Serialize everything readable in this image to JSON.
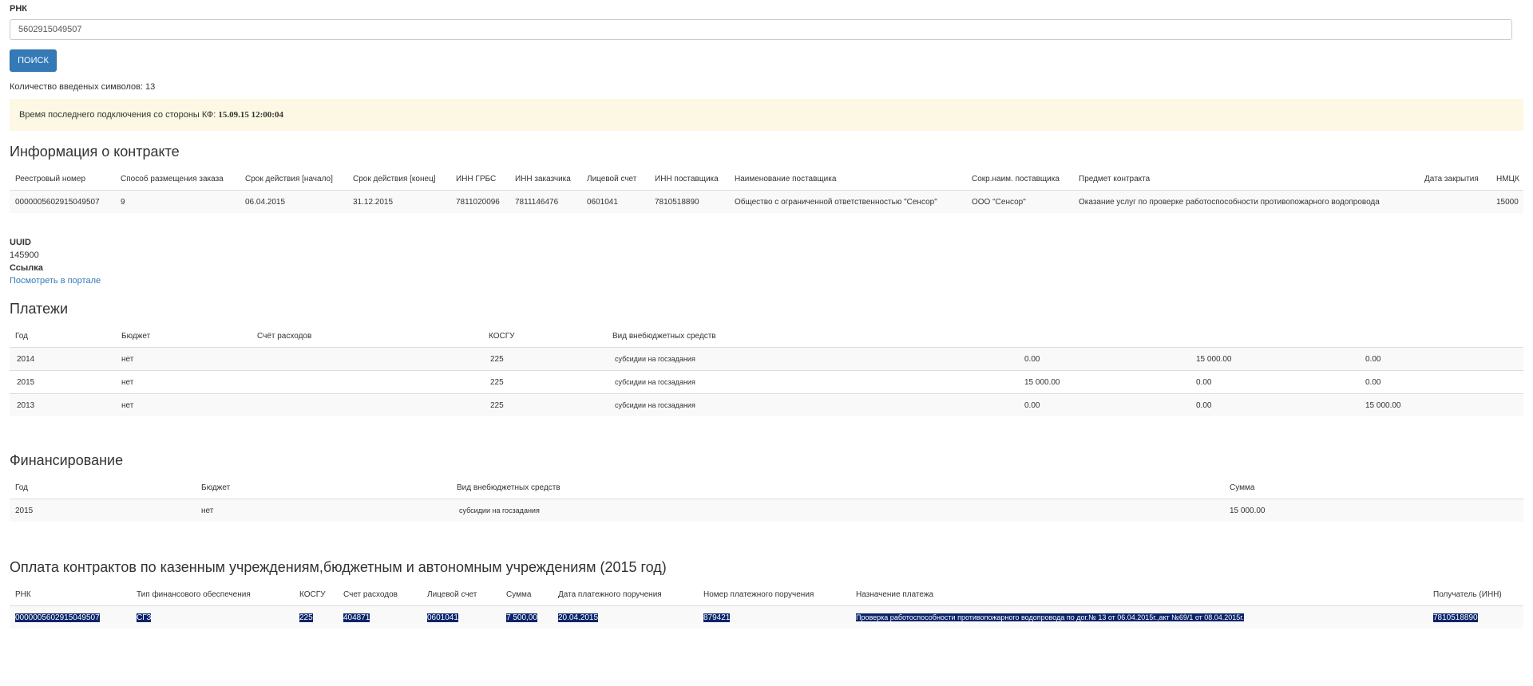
{
  "search": {
    "label": "РНК",
    "value": "5602915049507",
    "button": "ПОИСК",
    "char_count": "Количество введеных символов: 13"
  },
  "alert": {
    "text": "Время последнего подключения со стороны КФ:",
    "datetime": "15.09.15 12:00:04"
  },
  "contract": {
    "title": "Информация о контракте",
    "headers": [
      "Реестровый номер",
      "Способ размещения заказа",
      "Срок действия [начало]",
      "Срок действия [конец]",
      "ИНН ГРБС",
      "ИНН заказчика",
      "Лицевой счет",
      "ИНН поставщика",
      "Наименование поставщика",
      "Сокр.наим. поставщика",
      "Предмет контракта",
      "Дата закрытия",
      "НМЦК"
    ],
    "row": [
      "0000005602915049507",
      "9",
      "06.04.2015",
      "31.12.2015",
      "7811020096",
      "7811146476",
      "0601041",
      "7810518890",
      "Общество с ограниченной ответственностью \"Сенсор\"",
      "ООО \"Сенсор\"",
      "Оказание услуг по проверке работоспособности противопожарного водопровода",
      "",
      "15000"
    ]
  },
  "meta": {
    "uuid_label": "UUID",
    "uuid_value": "145900",
    "link_label": "Ссылка",
    "link_text": "Посмотреть в портале"
  },
  "payments": {
    "title": "Платежи",
    "headers": [
      "Год",
      "Бюджет",
      "Счёт расходов",
      "КОСГУ",
      "Вид внебюджетных средств"
    ],
    "rows": [
      [
        "2014",
        "нет",
        "",
        "225",
        "субсидии на госзадания",
        "0.00",
        "15 000.00",
        "0.00"
      ],
      [
        "2015",
        "нет",
        "",
        "225",
        "субсидии на госзадания",
        "15 000.00",
        "0.00",
        "0.00"
      ],
      [
        "2013",
        "нет",
        "",
        "225",
        "субсидии на госзадания",
        "0.00",
        "0.00",
        "15 000.00"
      ]
    ]
  },
  "financing": {
    "title": "Финансирование",
    "headers": [
      "Год",
      "Бюджет",
      "Вид внебюджетных средств",
      "Сумма"
    ],
    "rows": [
      [
        "2015",
        "нет",
        "субсидии на госзадания",
        "15 000.00"
      ]
    ]
  },
  "contract_payments": {
    "title": "Оплата контрактов по казенным учреждениям,бюджетным и автономным учреждениям (2015 год)",
    "headers": [
      "РНК",
      "Тип финансового обеспечения",
      "КОСГУ",
      "Счет расходов",
      "Лицевой счет",
      "Сумма",
      "Дата платежного поручения",
      "Номер платежного поручения",
      "Назначение платежа",
      "Получатель (ИНН)"
    ],
    "rows": [
      [
        "0000005602915049507",
        "СГЗ",
        "225",
        "404871",
        "0601041",
        "7 500,00",
        "20.04.2015",
        "879421",
        "Проверка работоспособности противопожарного водопровода по дог.№ 13 от 06.04.2015г.,акт №69/1 от 08.04.2015г.",
        "7810518890"
      ]
    ]
  }
}
